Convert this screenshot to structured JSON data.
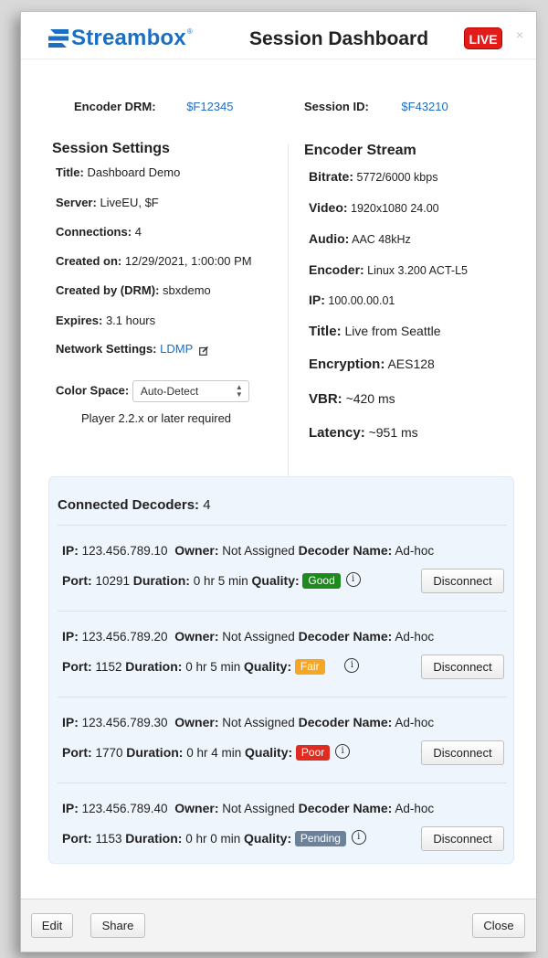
{
  "header": {
    "logo_text": "Streambox",
    "logo_tm": "®",
    "title": "Session Dashboard",
    "live_label": "LIVE",
    "close_glyph": "×"
  },
  "ids": {
    "encoder_drm_label": "Encoder DRM:",
    "encoder_drm_value": "$F12345",
    "session_id_label": "Session ID:",
    "session_id_value": "$F43210"
  },
  "session_settings": {
    "title": "Session Settings",
    "fields": [
      {
        "label": "Title:",
        "value": "Dashboard Demo"
      },
      {
        "label": "Server:",
        "value": "LiveEU, $F"
      },
      {
        "label": "Connections:",
        "value": "4"
      },
      {
        "label": "Created on:",
        "value": "12/29/2021, 1:00:00 PM"
      },
      {
        "label": "Created by (DRM):",
        "value": "sbxdemo"
      },
      {
        "label": "Expires:",
        "value": "3.1 hours"
      },
      {
        "label": "Network Settings:",
        "value": "LDMP"
      }
    ],
    "color_space_label": "Color Space:",
    "color_space_value": "Auto-Detect",
    "player_note": "Player 2.2.x or later required"
  },
  "encoder_stream": {
    "title": "Encoder Stream",
    "fields": [
      {
        "label": "Bitrate:",
        "value": "5772/6000 kbps"
      },
      {
        "label": "Video:",
        "value": "1920x1080 24.00"
      },
      {
        "label": "Audio:",
        "value": "AAC 48kHz"
      },
      {
        "label": "Encoder:",
        "value": "Linux 3.200 ACT-L5"
      },
      {
        "label": "IP:",
        "value": "100.00.00.01"
      },
      {
        "label": "Title:",
        "value": "Live from Seattle"
      },
      {
        "label": "Encryption:",
        "value": "AES128"
      },
      {
        "label": "VBR:",
        "value": "~420 ms"
      },
      {
        "label": "Latency:",
        "value": "~951 ms"
      }
    ]
  },
  "decoders": {
    "header_label": "Connected Decoders:",
    "count": "4",
    "labels": {
      "ip": "IP:",
      "owner": "Owner:",
      "decoder_name": "Decoder Name:",
      "port": "Port:",
      "duration": "Duration:",
      "quality": "Quality:",
      "disconnect": "Disconnect",
      "info_glyph": "i"
    },
    "rows": [
      {
        "ip": "123.456.789.10",
        "owner": "Not Assigned",
        "name": "Ad-hoc",
        "port": "10291",
        "duration": "0 hr 5 min",
        "quality": "Good",
        "quality_color": "#1e8a1e"
      },
      {
        "ip": "123.456.789.20",
        "owner": "Not Assigned",
        "name": "Ad-hoc",
        "port": "1152",
        "duration": "0 hr 5 min",
        "quality": "Fair",
        "quality_color": "#f5a623"
      },
      {
        "ip": "123.456.789.30",
        "owner": "Not Assigned",
        "name": "Ad-hoc",
        "port": "1770",
        "duration": "0 hr 4 min",
        "quality": "Poor",
        "quality_color": "#e02b20"
      },
      {
        "ip": "123.456.789.40",
        "owner": "Not Assigned",
        "name": "Ad-hoc",
        "port": "1153",
        "duration": "0 hr 0 min",
        "quality": "Pending",
        "quality_color": "#6b829a"
      }
    ]
  },
  "footer": {
    "edit_label": "Edit",
    "share_label": "Share",
    "close_label": "Close"
  },
  "colors": {
    "brand_blue": "#1b6fc3",
    "live_red": "#e31b1b",
    "panel_bg": "#eef5fc"
  }
}
